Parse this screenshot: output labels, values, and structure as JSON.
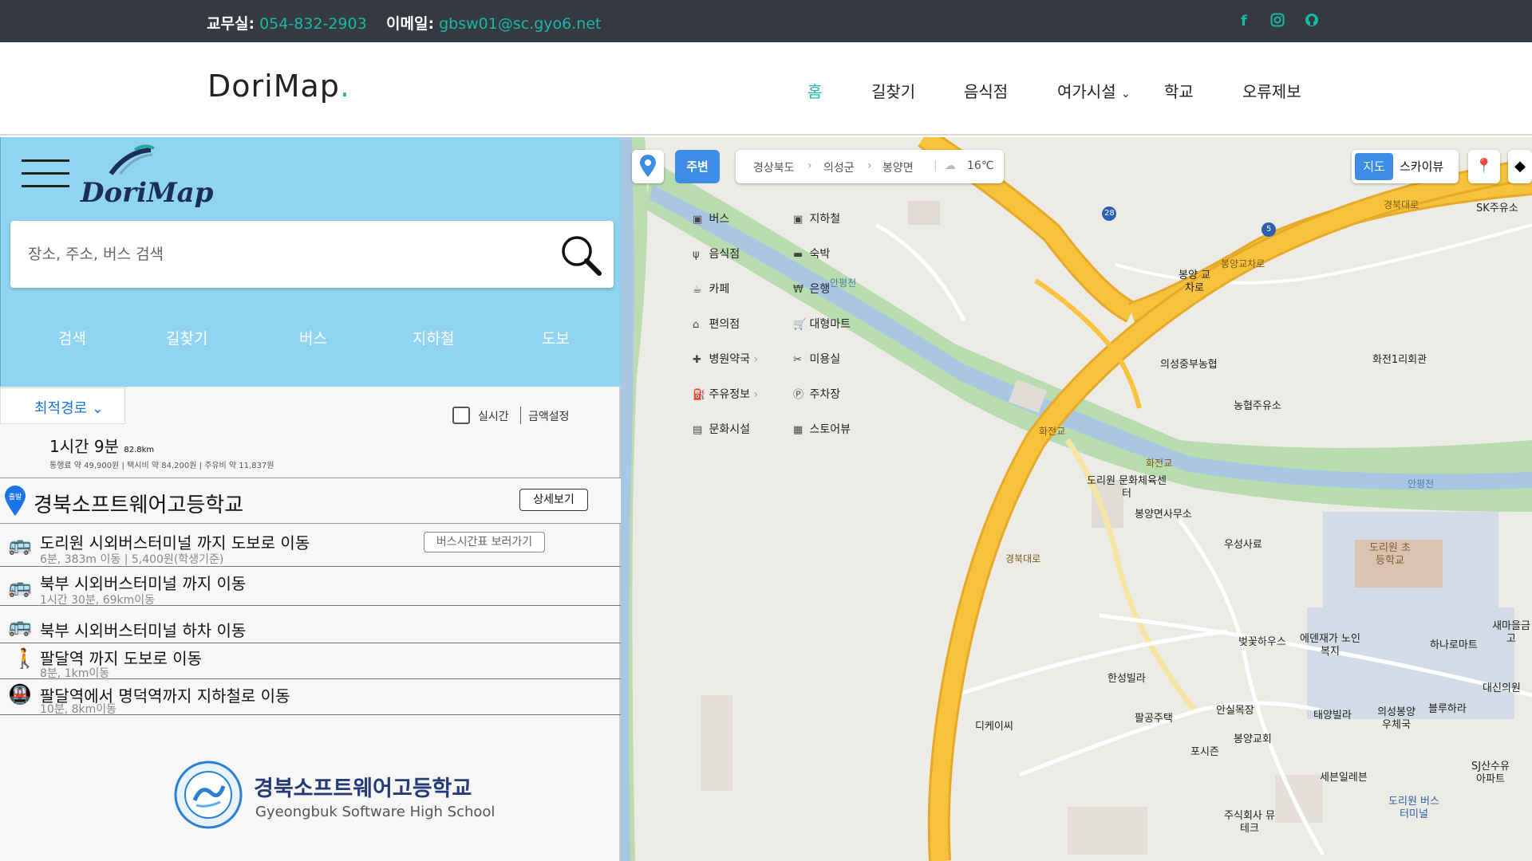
{
  "topbar": {
    "office_label": "교무실:",
    "office_value": "054-832-2903",
    "email_label": "이메일:",
    "email_value": "gbsw01@sc.gyo6.net",
    "social": [
      "facebook-icon",
      "instagram-icon",
      "github-icon"
    ]
  },
  "header": {
    "logo": "DoriMap",
    "logo_dot": ".",
    "nav": [
      "홈",
      "길찾기",
      "음식점",
      "여가시설",
      "학교",
      "오류제보"
    ],
    "active_nav": "홈"
  },
  "panel": {
    "brand": "DoriMap",
    "search_placeholder": "장소, 주소, 버스 검색",
    "tabs": [
      "검색",
      "길찾기",
      "버스",
      "지하철",
      "도보"
    ],
    "route_option": "최적경로",
    "realtime_label": "실시간",
    "fare_label": "금액설정",
    "summary": {
      "time": "1시간 9분",
      "distance": "82.8km",
      "fares": "통행료 약 49,900원 | 택시비 약 84,200원 | 주유비 약 11,837원"
    },
    "start": {
      "badge": "출발",
      "name": "경북소프트웨어고등학교",
      "detail_button": "상세보기"
    },
    "steps": [
      {
        "title": "도리원 시외버스터미널 까지 도보로 이동",
        "sub": "6분, 383m 이동 |    5,400원(학생기준)",
        "link": "버스시간표 보러가기"
      },
      {
        "title": "북부 시외버스터미널 까지 이동",
        "sub": "1시간 30분, 69km이동"
      },
      {
        "title": "북부 시외버스터미널 하차 이동",
        "sub": ""
      },
      {
        "title": "팔달역 까지 도보로 이동",
        "sub": "8분, 1km이동"
      },
      {
        "title": "팔달역에서 명덕역까지 지하철로 이동",
        "sub": "10분, 8km이동"
      }
    ],
    "school_kr": "경북소프트웨어고등학교",
    "school_en": "Gyeongbuk Software High School"
  },
  "map": {
    "nearby_button": "주변",
    "breadcrumb": [
      "경상북도",
      "의성군",
      "봉양면"
    ],
    "weather": "16℃",
    "view_map": "지도",
    "view_sky": "스카이뷰",
    "categories_left": [
      "버스",
      "음식점",
      "카페",
      "편의점",
      "병원약국",
      "주유정보",
      "문화시설"
    ],
    "categories_right": [
      "지하철",
      "숙박",
      "은행",
      "대형마트",
      "미용실",
      "주차장",
      "스토어뷰"
    ],
    "pois": [
      "SK주유소",
      "봉양 교차로",
      "의성중부농협",
      "화전1리회관",
      "농협주유소",
      "도리원 문화체육센터",
      "봉양면사무소",
      "우성사료",
      "도리원 초등학교",
      "새마을금고",
      "하나로마트",
      "벚꽃하우스",
      "에덴재가 노인복지",
      "대신의원",
      "한성빌라",
      "태양빌라",
      "의성봉양 우체국",
      "블루하라",
      "팔공주택",
      "안실목장",
      "디케이씨",
      "포시즌",
      "봉양교회",
      "SJ산수유 아파트",
      "세븐일레븐",
      "도리원 버스터미널",
      "주식회사 뮤테크"
    ],
    "road_labels": [
      "경북대로",
      "봉양교차로",
      "화전교",
      "안평천",
      "경북대로",
      "화전교",
      "안평천"
    ],
    "route_numbers": [
      "28",
      "5"
    ]
  }
}
